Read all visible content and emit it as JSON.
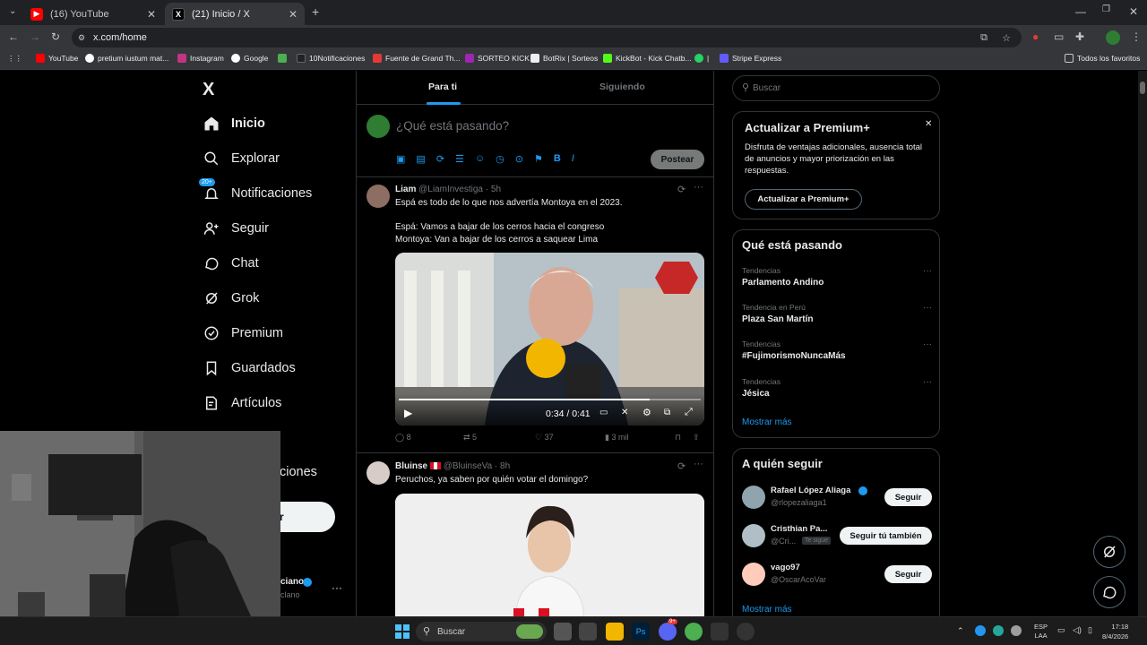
{
  "browser": {
    "tabs": [
      {
        "title": "(16) YouTube",
        "active": false
      },
      {
        "title": "(21) Inicio / X",
        "active": true
      }
    ],
    "new_tab": "+",
    "url": "x.com/home",
    "bookmarks": [
      "YouTube",
      "pretium iustum mat...",
      "Instagram",
      "Google",
      "10Notificaciones",
      "Fuente de Grand Th...",
      "SORTEO KICK",
      "BotRix | Sorteos",
      "KickBot - Kick Chatb...",
      "|",
      "Stripe Express"
    ],
    "all_bookmarks": "Todos los favoritos"
  },
  "nav": {
    "logo": "X",
    "items": [
      {
        "label": "Inicio",
        "icon": "home-icon"
      },
      {
        "label": "Explorar",
        "icon": "search-icon"
      },
      {
        "label": "Notificaciones",
        "icon": "bell-icon",
        "badge": "20+"
      },
      {
        "label": "Seguir",
        "icon": "add-person-icon"
      },
      {
        "label": "Chat",
        "icon": "chat-icon"
      },
      {
        "label": "Grok",
        "icon": "grok-icon"
      },
      {
        "label": "Premium",
        "icon": "premium-icon"
      },
      {
        "label": "Guardados",
        "icon": "bookmark-icon"
      },
      {
        "label": "Artículos",
        "icon": "articles-icon"
      }
    ],
    "partial_label": "ciones",
    "post_partial": "r",
    "profile_partial_name": "ciano",
    "profile_partial_handle": "clano"
  },
  "feed": {
    "tabs": [
      "Para ti",
      "Siguiendo"
    ],
    "composer_placeholder": "¿Qué está pasando?",
    "post_button": "Postear",
    "tweets": [
      {
        "name": "Liam",
        "handle": "@LiamInvestiga",
        "time": "5h",
        "text1": "Espá es todo de lo que nos advertía Montoya en el 2023.",
        "text2": "Espá: Vamos a bajar de los cerros hacia el congreso",
        "text3": "Montoya: Van a bajar de los cerros a saquear Lima",
        "video_time": "0:34 / 0:41",
        "replies": "8",
        "retweets": "5",
        "likes": "37",
        "views": "3 mil"
      },
      {
        "name": "Bluinse",
        "handle": "@BluinseVa",
        "time": "8h",
        "text1": "Peruchos, ya saben por quién votar el domingo?"
      }
    ]
  },
  "sidebar": {
    "search_placeholder": "Buscar",
    "premium": {
      "title": "Actualizar a Premium+",
      "body": "Disfruta de ventajas adicionales, ausencia total de anuncios y mayor priorización en las respuestas.",
      "button": "Actualizar a Premium+"
    },
    "trends": {
      "title": "Qué está pasando",
      "items": [
        {
          "label": "Tendencias",
          "value": "Parlamento Andino"
        },
        {
          "label": "Tendencia en Perú",
          "value": "Plaza San Martín"
        },
        {
          "label": "Tendencias",
          "value": "#FujimorismoNuncaMás"
        },
        {
          "label": "Tendencias",
          "value": "Jésica"
        }
      ],
      "more": "Mostrar más"
    },
    "follow": {
      "title": "A quién seguir",
      "items": [
        {
          "name": "Rafael López Aliaga",
          "handle": "@rlopezaliaga1",
          "button": "Seguir",
          "verified": true
        },
        {
          "name": "Cristhian Pa...",
          "handle": "@Cri...",
          "badge": "Te sigue",
          "button": "Seguir tú también"
        },
        {
          "name": "vago97",
          "handle": "@OscarAcoVar",
          "button": "Seguir"
        }
      ],
      "more": "Mostrar más"
    }
  },
  "taskbar": {
    "search": "Buscar",
    "lang1": "ESP",
    "lang2": "LAA",
    "time": "17:18",
    "date": "8/4/2026",
    "badge": "9+"
  },
  "colors": {
    "accent": "#1d9bf0",
    "background": "#000000",
    "border": "#2f3336"
  }
}
